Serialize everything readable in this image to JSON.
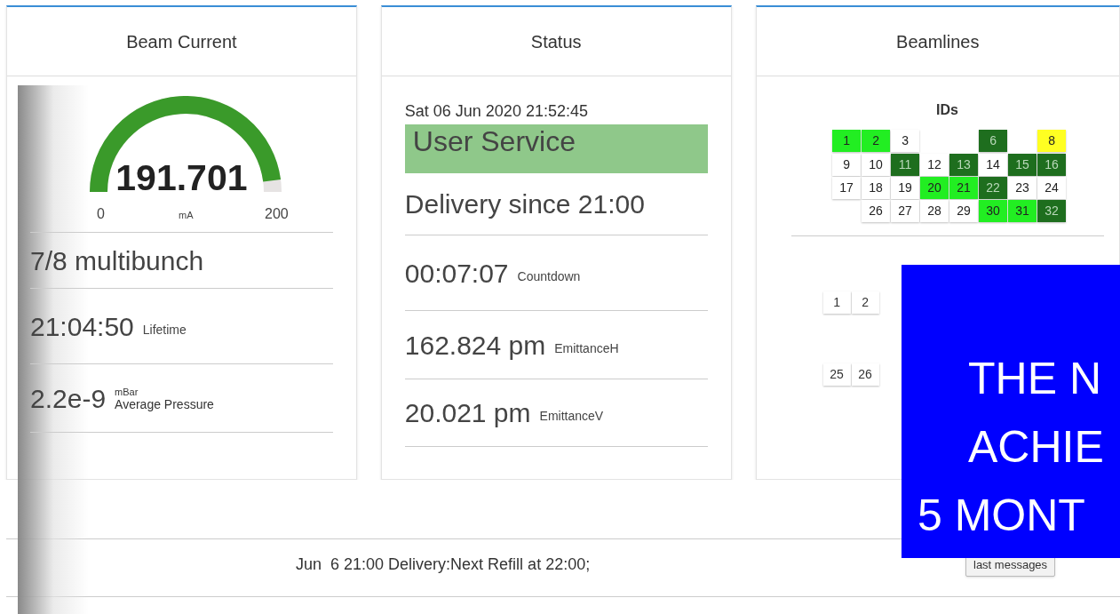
{
  "beam_current": {
    "title": "Beam Current",
    "gauge": {
      "value": "191.701",
      "level": 0.9585,
      "min": "0",
      "max": "200",
      "unit": "mA"
    },
    "rows": [
      {
        "kind": "text",
        "value": "7/8 multibunch"
      },
      {
        "kind": "value",
        "value": "21:04:50",
        "label": "Lifetime"
      },
      {
        "kind": "unit_value",
        "value": "2.2e-9",
        "unit": "mBar",
        "label": "Average Pressure"
      }
    ]
  },
  "status": {
    "title": "Status",
    "datetime": "Sat 06 Jun 2020 21:52:45",
    "mode": "User Service",
    "rows": [
      {
        "kind": "text",
        "value": "Delivery since 21:00"
      },
      {
        "kind": "value",
        "value": "00:07:07",
        "label": "Countdown"
      },
      {
        "kind": "value",
        "value": "162.824 pm",
        "label": "EmittanceH"
      },
      {
        "kind": "value",
        "value": "20.021 pm",
        "label": "EmittanceV"
      }
    ]
  },
  "beamlines": {
    "title": "Beamlines",
    "ids_heading": "IDs",
    "ids": [
      {
        "label": "1",
        "color": "#22ee22"
      },
      {
        "label": "2",
        "color": "#22ee22"
      },
      {
        "label": "3",
        "color": "#ffffff"
      },
      {
        "kind": "blank"
      },
      {
        "kind": "blank"
      },
      {
        "label": "6",
        "color": "#1e6e1e"
      },
      {
        "kind": "blank"
      },
      {
        "label": "8",
        "color": "#ffff22"
      },
      {
        "label": "9",
        "color": "#ffffff"
      },
      {
        "label": "10",
        "color": "#ffffff"
      },
      {
        "label": "11",
        "color": "#1e6e1e"
      },
      {
        "label": "12",
        "color": "#ffffff"
      },
      {
        "label": "13",
        "color": "#1e6e1e"
      },
      {
        "label": "14",
        "color": "#ffffff"
      },
      {
        "label": "15",
        "color": "#1e6e1e"
      },
      {
        "label": "16",
        "color": "#1e6e1e"
      },
      {
        "label": "17",
        "color": "#ffffff"
      },
      {
        "label": "18",
        "color": "#ffffff"
      },
      {
        "label": "19",
        "color": "#ffffff"
      },
      {
        "label": "20",
        "color": "#22ee22"
      },
      {
        "label": "21",
        "color": "#22ee22"
      },
      {
        "label": "22",
        "color": "#1e6e1e"
      },
      {
        "label": "23",
        "color": "#ffffff"
      },
      {
        "label": "24",
        "color": "#ffffff"
      },
      {
        "kind": "blank"
      },
      {
        "label": "26",
        "color": "#ffffff"
      },
      {
        "label": "27",
        "color": "#ffffff"
      },
      {
        "label": "28",
        "color": "#ffffff"
      },
      {
        "label": "29",
        "color": "#ffffff"
      },
      {
        "label": "30",
        "color": "#22ee22"
      },
      {
        "label": "31",
        "color": "#22ee22"
      },
      {
        "label": "32",
        "color": "#1e6e1e"
      }
    ],
    "bending_rows": [
      [
        "1",
        "2"
      ],
      [
        "25",
        "26"
      ]
    ]
  },
  "overlay": {
    "lines": [
      "THE N",
      "ACHIE",
      "5 MONT"
    ]
  },
  "message_bar": {
    "message": "Jun  6 21:00 Delivery:Next Refill at 22:00;",
    "button": "last messages"
  }
}
